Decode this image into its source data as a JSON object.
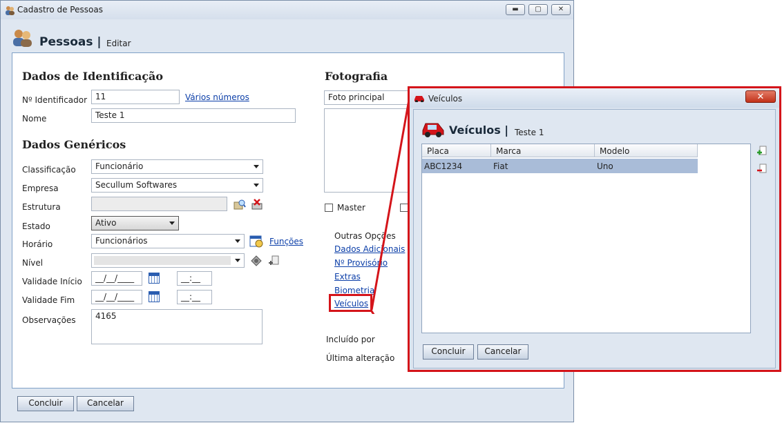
{
  "main_window": {
    "title": "Cadastro de Pessoas",
    "header_title": "Pessoas |",
    "header_subtitle": "Editar",
    "controls": [
      "minimize-icon",
      "maximize-icon",
      "close-icon"
    ]
  },
  "identificacao": {
    "section": "Dados de Identificação",
    "identificador_label": "Nº Identificador",
    "identificador_value": "11",
    "varios_numeros": "Vários números",
    "nome_label": "Nome",
    "nome_value": "Teste 1"
  },
  "genericos": {
    "section": "Dados Genéricos",
    "classificacao_label": "Classificação",
    "classificacao_value": "Funcionário",
    "empresa_label": "Empresa",
    "empresa_value": "Secullum Softwares",
    "estrutura_label": "Estrutura",
    "estado_label": "Estado",
    "estado_value": "Ativo",
    "horario_label": "Horário",
    "horario_value": "Funcionários",
    "funcoes": "Funções",
    "nivel_label": "Nível",
    "validade_inicio_label": "Validade Início",
    "validade_fim_label": "Validade Fim",
    "date_placeholder": "__/__/____",
    "time_placeholder": "__:__",
    "observacoes_label": "Observações",
    "observacoes_value": "4165"
  },
  "fotografia": {
    "section": "Fotografia",
    "foto_select": "Foto principal",
    "master_label": "Master"
  },
  "outras_opcoes": {
    "heading": "Outras Opções",
    "links": [
      "Dados Adicionais",
      "Nº Provisório",
      "Extras",
      "Biometria",
      "Veículos"
    ]
  },
  "meta": {
    "incluido_por": "Incluído por",
    "ultima_alteracao": "Última alteração"
  },
  "footer": {
    "concluir": "Concluir",
    "cancelar": "Cancelar"
  },
  "veiculos_dialog": {
    "title": "Veículos",
    "header_title": "Veículos |",
    "header_subtitle": "Teste 1",
    "columns": [
      "Placa",
      "Marca",
      "Modelo"
    ],
    "rows": [
      {
        "placa": "ABC1234",
        "marca": "Fiat",
        "modelo": "Uno"
      }
    ],
    "concluir": "Concluir",
    "cancelar": "Cancelar"
  },
  "colors": {
    "highlight_red": "#d4141a",
    "link_blue": "#0b3ea8",
    "selected_row": "#a9bcd8"
  }
}
